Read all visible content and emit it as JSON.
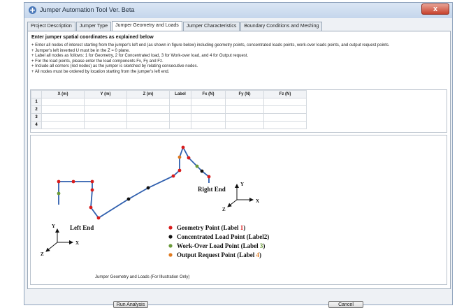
{
  "window": {
    "title": "Jumper Automation Tool  Ver. Beta",
    "close_label": "x"
  },
  "tabs": [
    {
      "label": "Project Description"
    },
    {
      "label": "Jumper Type"
    },
    {
      "label": "Jumper Geometry and Loads"
    },
    {
      "label": "Jumper Characteristics"
    },
    {
      "label": "Boundary Conditions and Meshing"
    }
  ],
  "active_tab": "Jumper Geometry and Loads",
  "main": {
    "heading": "Enter jumper spatial coordinates as explained below",
    "instructions": [
      "+ Enter all nodes of interest starting from the jumper's left end (as shown in figure below) including geometry points, concentrated loads points, work-over loads points, and output request points.",
      "+ Jumper's left inverted U must be in the Z = 0 plane.",
      "+ Label all nodes as follows: 1 for Geometry, 2 for Concentrated load, 3 for Work-over load, and 4 for Output request.",
      "+ For the load points, please enter the load components Fx, Fy and Fz.",
      "+ Include all corners (red nodes) as the jumper is sketched by relating consecutive nodes.",
      "+ All nodes must be ordered by location starting from the jumper's left end."
    ]
  },
  "table": {
    "columns": [
      "X (m)",
      "Y (m)",
      "Z (m)",
      "Label",
      "Fx (N)",
      "Fy (N)",
      "Fz (N)"
    ],
    "rows": [
      {
        "num": "1",
        "cells": [
          "",
          "",
          "",
          "",
          "",
          "",
          ""
        ]
      },
      {
        "num": "2",
        "cells": [
          "",
          "",
          "",
          "",
          "",
          "",
          ""
        ]
      },
      {
        "num": "3",
        "cells": [
          "",
          "",
          "",
          "",
          "",
          "",
          ""
        ]
      },
      {
        "num": "4",
        "cells": [
          "",
          "",
          "",
          "",
          "",
          "",
          ""
        ]
      }
    ]
  },
  "figure": {
    "left_end_label": "Left End",
    "right_end_label": "Right End",
    "axis_y": "Y",
    "axis_x": "X",
    "axis_z": "Z",
    "legend_geometry_prefix": "Geometry Point (Label ",
    "legend_geometry_num": "1",
    "legend_concentrated_prefix": "Concentrated Load Point (Label",
    "legend_concentrated_num": "2",
    "legend_workover_prefix": "Work-Over Load Point (Label ",
    "legend_workover_num": "3",
    "legend_output_prefix": "Output Request Point (Label ",
    "legend_output_num": "4",
    "legend_suffix": ")",
    "caption": "Jumper Geometry and Loads (For Illustration Only)",
    "colors": {
      "line": "#2f5fae",
      "geometry": "#d81b1b",
      "concentrated": "#111111",
      "workover": "#6a9a3a",
      "output": "#e07a1f"
    }
  },
  "buttons": {
    "run": "Run Analysis",
    "cancel": "Cancel"
  }
}
